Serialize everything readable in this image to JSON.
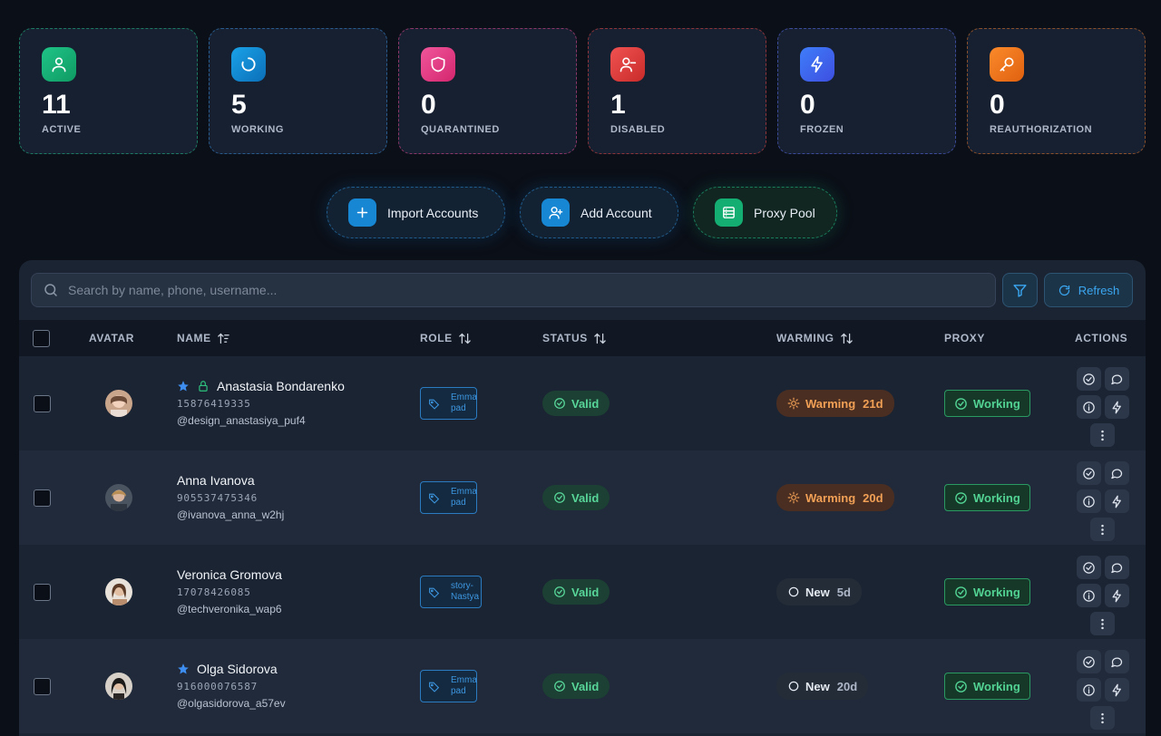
{
  "stats": [
    {
      "value": "11",
      "label": "ACTIVE",
      "icon": "user-icon",
      "color": "#1fc487"
    },
    {
      "value": "5",
      "label": "WORKING",
      "icon": "loader-icon",
      "color": "#1aa2e8"
    },
    {
      "value": "0",
      "label": "QUARANTINED",
      "icon": "shield-icon",
      "color": "#f0569b"
    },
    {
      "value": "1",
      "label": "DISABLED",
      "icon": "user-minus-icon",
      "color": "#f05252"
    },
    {
      "value": "0",
      "label": "FROZEN",
      "icon": "lightning-icon",
      "color": "#3f7dfa"
    },
    {
      "value": "0",
      "label": "REAUTHORIZATION",
      "icon": "key-icon",
      "color": "#fb8a2b"
    }
  ],
  "actions": {
    "import_label": "Import Accounts",
    "add_label": "Add Account",
    "proxy_label": "Proxy Pool"
  },
  "search": {
    "placeholder": "Search by name, phone, username..."
  },
  "toolbar": {
    "refresh_label": "Refresh"
  },
  "columns": {
    "avatar": "AVATAR",
    "name": "NAME",
    "role": "ROLE",
    "status": "STATUS",
    "warming": "WARMING",
    "proxy": "PROXY",
    "actions": "ACTIONS"
  },
  "rows": [
    {
      "name": "Anastasia Bondarenko",
      "phone": "15876419335",
      "username": "@design_anastasiya_puf4",
      "starred": true,
      "locked": true,
      "role_line1": "Emma",
      "role_line2": "pad",
      "status": "Valid",
      "warming_label": "Warming",
      "warming_days": "21d",
      "warming_type": "warming",
      "proxy": "Working"
    },
    {
      "name": "Anna Ivanova",
      "phone": "905537475346",
      "username": "@ivanova_anna_w2hj",
      "starred": false,
      "locked": false,
      "role_line1": "Emma",
      "role_line2": "pad",
      "status": "Valid",
      "warming_label": "Warming",
      "warming_days": "20d",
      "warming_type": "warming",
      "proxy": "Working"
    },
    {
      "name": "Veronica Gromova",
      "phone": "17078426085",
      "username": "@techveronika_wap6",
      "starred": false,
      "locked": false,
      "role_line1": "story-",
      "role_line2": "Nastya",
      "status": "Valid",
      "warming_label": "New",
      "warming_days": "5d",
      "warming_type": "new",
      "proxy": "Working"
    },
    {
      "name": "Olga Sidorova",
      "phone": "916000076587",
      "username": "@olgasidorova_a57ev",
      "starred": true,
      "locked": false,
      "role_line1": "Emma",
      "role_line2": "pad",
      "status": "Valid",
      "warming_label": "New",
      "warming_days": "20d",
      "warming_type": "new",
      "proxy": "Working"
    }
  ]
}
